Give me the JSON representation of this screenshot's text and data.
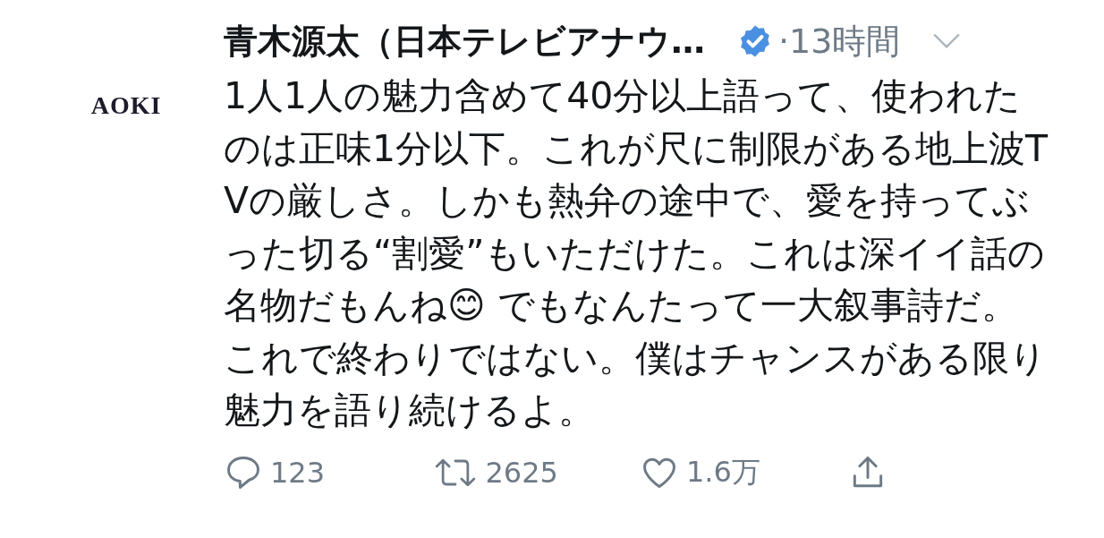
{
  "tweet": {
    "avatar_text": "AOKI",
    "name": "青木源太（日本テレビアナウ…",
    "verified": true,
    "time": "·13時間",
    "body": "1人1人の魅力含めて40分以上語って、使われたのは正味1分以下。これが尺に制限がある地上波TVの厳しさ。しかも熱弁の途中で、愛を持ってぶった切る“割愛”もいただけた。これは深イイ話の名物だもんね😊 でもなんたって一大叙事詩だ。これで終わりではない。僕はチャンスがある限り魅力を語り続けるよ。",
    "actions": [
      {
        "kind": "reply",
        "count": "123"
      },
      {
        "kind": "retweet",
        "count": "2625"
      },
      {
        "kind": "like",
        "count": "1.6万"
      },
      {
        "kind": "share"
      }
    ]
  }
}
